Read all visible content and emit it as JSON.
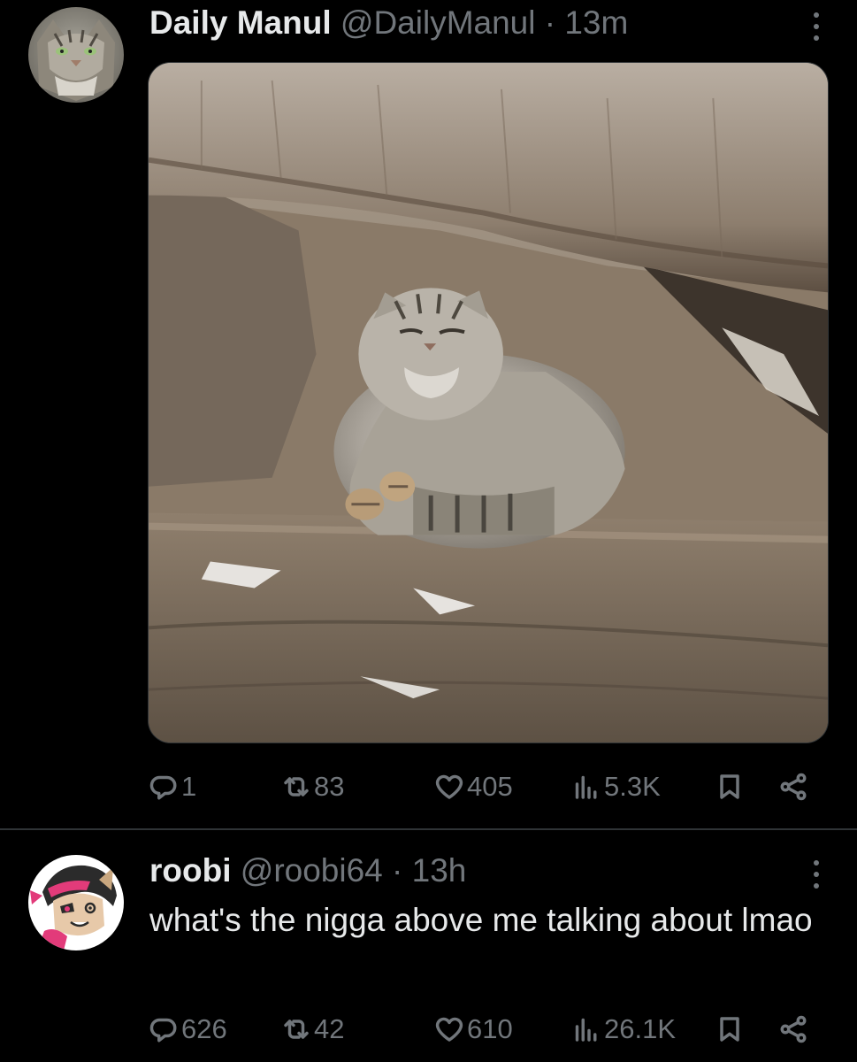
{
  "tweets": [
    {
      "display_name": "Daily Manul",
      "handle": "@DailyManul",
      "separator": "·",
      "time": "13m",
      "text": "",
      "media_description_icon": "manul-cat-photo",
      "avatar_icon": "manul-avatar",
      "stats": {
        "replies": "1",
        "retweets": "83",
        "likes": "405",
        "views": "5.3K"
      }
    },
    {
      "display_name": "roobi",
      "handle": "@roobi64",
      "separator": "·",
      "time": "13h",
      "text": "what's the nigga above me talking about lmao",
      "avatar_icon": "cartoon-character-avatar",
      "stats": {
        "replies": "626",
        "retweets": "42",
        "likes": "610",
        "views": "26.1K"
      }
    }
  ],
  "colors": {
    "background": "#000000",
    "primary_text": "#e7e9ea",
    "secondary_text": "#71767b",
    "divider": "#2f3336"
  },
  "icons": {
    "reply": "reply-icon",
    "retweet": "retweet-icon",
    "like": "heart-icon",
    "views": "views-icon",
    "bookmark": "bookmark-icon",
    "share": "share-icon",
    "more": "more-dots-icon"
  }
}
